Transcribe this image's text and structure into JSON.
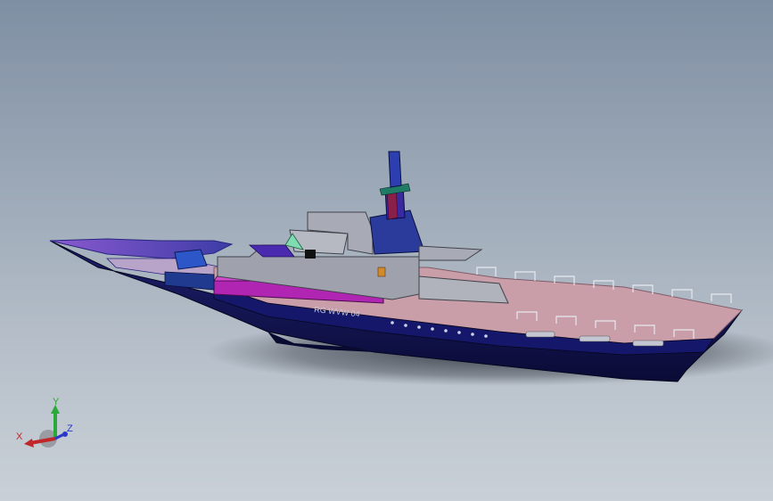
{
  "viewport": {
    "background_top": "#7f8fa3",
    "background_bottom": "#c9d0d7"
  },
  "model": {
    "hull_color": "#10124d",
    "deck_color": "#c9a0ae",
    "superstructure_color": "#9b9fa8",
    "accent_magenta": "#b125b3",
    "accent_blue": "#2a3b9c",
    "bow_color": "#6c4bc7",
    "hull_marking": "RG WVW 04"
  },
  "triad": {
    "x_label": "X",
    "y_label": "Y",
    "z_label": "Z",
    "x_color": "#c0262a",
    "y_color": "#2aa83a",
    "z_color": "#2a37c9"
  }
}
